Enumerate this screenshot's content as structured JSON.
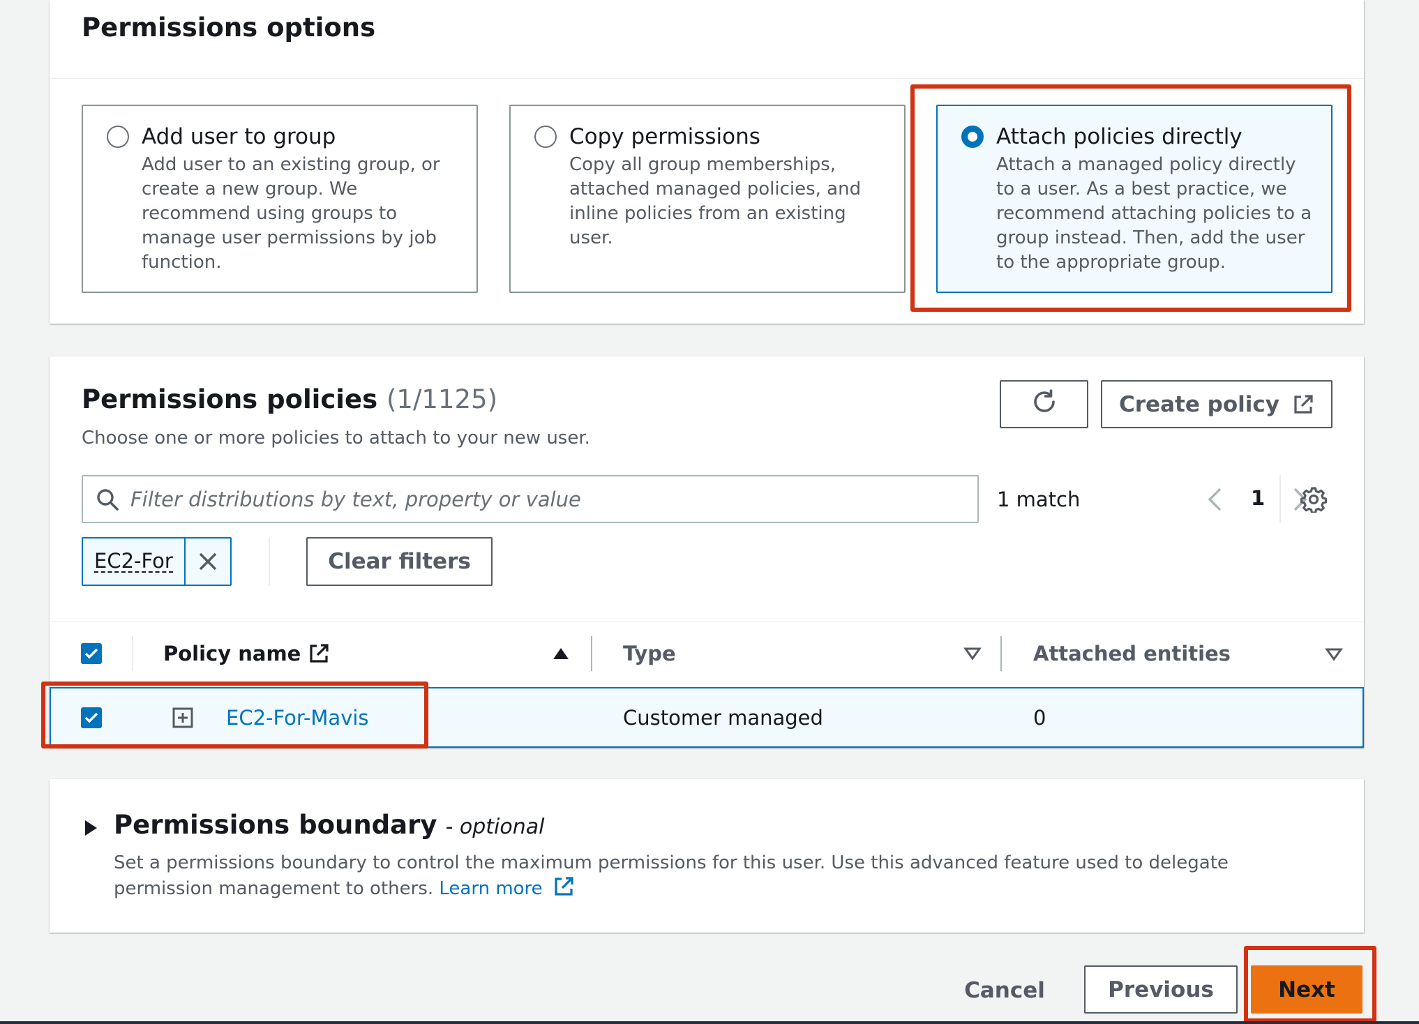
{
  "options": {
    "title": "Permissions options",
    "tiles": [
      {
        "title": "Add user to group",
        "description": "Add user to an existing group, or create a new group. We recommend using groups to manage user permissions by job function.",
        "selected": false
      },
      {
        "title": "Copy permissions",
        "description": "Copy all group memberships, attached managed policies, and inline policies from an existing user.",
        "selected": false
      },
      {
        "title": "Attach policies directly",
        "description": "Attach a managed policy directly to a user. As a best practice, we recommend attaching policies to a group instead. Then, add the user to the appropriate group.",
        "selected": true
      }
    ]
  },
  "policies": {
    "title": "Permissions policies",
    "count": "(1/1125)",
    "subtitle": "Choose one or more policies to attach to your new user.",
    "create_policy_label": "Create policy",
    "search_placeholder": "Filter distributions by text, property or value",
    "match_text": "1 match",
    "page": "1",
    "filter_token": "EC2-For",
    "clear_filters_label": "Clear filters",
    "columns": {
      "policy_name": "Policy name",
      "type": "Type",
      "attached": "Attached entities"
    },
    "rows": [
      {
        "name": "EC2-For-Mavis",
        "type": "Customer managed",
        "attached": "0",
        "checked": true
      }
    ]
  },
  "boundary": {
    "title": "Permissions boundary",
    "optional": "- optional",
    "description": "Set a permissions boundary to control the maximum permissions for this user. Use this advanced feature used to delegate permission management to others.",
    "learn_more": "Learn more"
  },
  "footer": {
    "cancel_label": "Cancel",
    "previous_label": "Previous",
    "next_label": "Next"
  },
  "colors": {
    "accent": "#0073bb",
    "primary_button": "#ec7211",
    "highlight": "#d13212"
  }
}
